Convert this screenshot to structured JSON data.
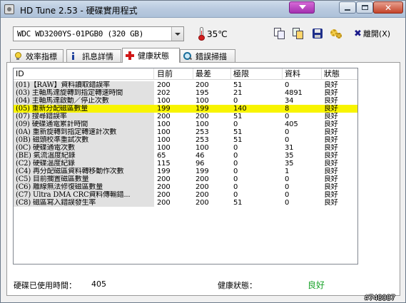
{
  "window": {
    "title": "HD Tune 2.53 - 硬碟實用程式"
  },
  "toolbar": {
    "drive": "WDC WD3200YS-01PGB0 (320 GB)",
    "temperature": "35℃",
    "exit_label": "離開(X)",
    "icons": [
      "copy-text-icon",
      "copy-screenshot-icon",
      "save-icon",
      "options-icon"
    ]
  },
  "tabs": [
    {
      "label": "效率指標",
      "icon": "benchmark-bulb-icon",
      "active": false
    },
    {
      "label": "訊息詳情",
      "icon": "info-icon",
      "active": false
    },
    {
      "label": "健康狀態",
      "icon": "health-cross-icon",
      "active": true
    },
    {
      "label": "錯誤掃描",
      "icon": "error-scan-icon",
      "active": false
    }
  ],
  "smart": {
    "columns": [
      "ID",
      "目前",
      "最差",
      "極限",
      "資料",
      "狀態"
    ],
    "rows": [
      {
        "id": "(01)【RAW】資料讀取錯誤率",
        "current": "200",
        "worst": "200",
        "threshold": "51",
        "data": "0",
        "status": "良好"
      },
      {
        "id": "(03) 主軸馬達旋轉到指定轉速時間",
        "current": "202",
        "worst": "195",
        "threshold": "21",
        "data": "4891",
        "status": "良好"
      },
      {
        "id": "(04) 主軸馬達啟動／停止次數",
        "current": "100",
        "worst": "100",
        "threshold": "0",
        "data": "34",
        "status": "良好"
      },
      {
        "id": "(05) 重新分配磁區數量",
        "current": "199",
        "worst": "199",
        "threshold": "140",
        "data": "8",
        "status": "良好"
      },
      {
        "id": "(07) 搜尋錯誤率",
        "current": "200",
        "worst": "200",
        "threshold": "51",
        "data": "0",
        "status": "良好"
      },
      {
        "id": "(09) 硬碟通電累計時間",
        "current": "100",
        "worst": "100",
        "threshold": "0",
        "data": "405",
        "status": "良好"
      },
      {
        "id": "(0A) 重新旋轉到指定轉速計次數",
        "current": "100",
        "worst": "253",
        "threshold": "51",
        "data": "0",
        "status": "良好"
      },
      {
        "id": "(0B) 磁頭校準重試次數",
        "current": "100",
        "worst": "253",
        "threshold": "51",
        "data": "0",
        "status": "良好"
      },
      {
        "id": "(0C) 硬碟通電次數",
        "current": "100",
        "worst": "100",
        "threshold": "0",
        "data": "31",
        "status": "良好"
      },
      {
        "id": "(BE) 氣流溫度紀錄",
        "current": "65",
        "worst": "46",
        "threshold": "0",
        "data": "35",
        "status": "良好"
      },
      {
        "id": "(C2) 硬碟溫度紀錄",
        "current": "115",
        "worst": "96",
        "threshold": "0",
        "data": "35",
        "status": "良好"
      },
      {
        "id": "(C4) 再分配磁區資料轉移動作次數",
        "current": "199",
        "worst": "199",
        "threshold": "0",
        "data": "1",
        "status": "良好"
      },
      {
        "id": "(C5) 目前擱置磁區數量",
        "current": "200",
        "worst": "200",
        "threshold": "0",
        "data": "0",
        "status": "良好"
      },
      {
        "id": "(C6) 離線無法修復磁區數量",
        "current": "200",
        "worst": "200",
        "threshold": "0",
        "data": "0",
        "status": "良好"
      },
      {
        "id": "(C7) Ultra DMA CRC資料傳輸錯...",
        "current": "200",
        "worst": "200",
        "threshold": "0",
        "data": "0",
        "status": "良好"
      },
      {
        "id": "(C8) 磁區寫入錯誤發生率",
        "current": "200",
        "worst": "200",
        "threshold": "51",
        "data": "0",
        "status": "良好"
      }
    ],
    "highlight_color": "#f8f400"
  },
  "footer": {
    "power_on_label": "硬碟已使用時間：",
    "power_on_value": "405",
    "health_label": "健康狀態：",
    "health_value": "良好",
    "health_color": "#1aa32a"
  },
  "watermark": "#748087"
}
